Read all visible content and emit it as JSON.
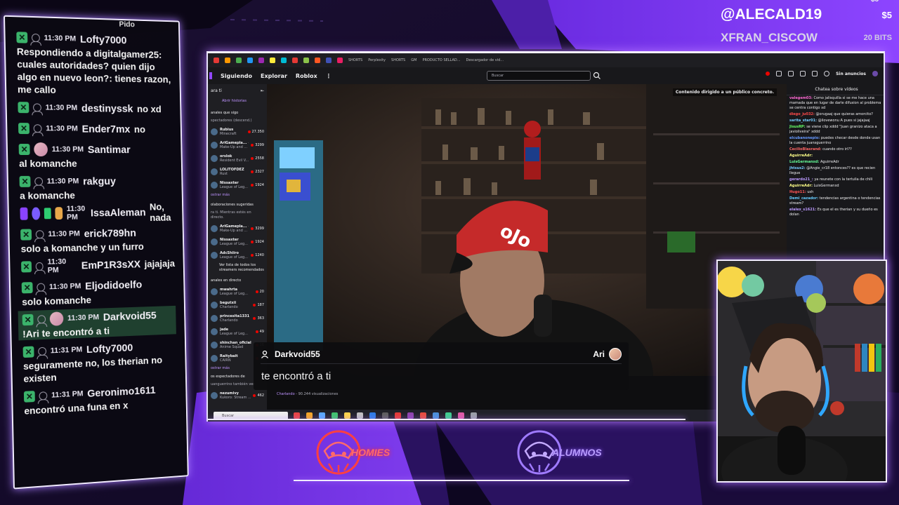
{
  "bits": {
    "top_amount": "$5",
    "row1": {
      "name": "@ALECALD19",
      "amount": "$5"
    },
    "row2": {
      "name": "XFRAN_CISCOW",
      "amount": "20 BITS"
    }
  },
  "stream_chat": {
    "messages": [
      {
        "time": "11:30 PM",
        "user": "Lofty7000",
        "text": "Respondiendo a digitalgamer25: cuales autoridades? quien dijo algo en nuevo leon?: tienes razon, me callo",
        "badges": [
          "mod",
          "user"
        ]
      },
      {
        "time": "11:30 PM",
        "user": "destinyssk",
        "text": "no xd",
        "badges": [
          "mod",
          "user"
        ]
      },
      {
        "time": "11:30 PM",
        "user": "Ender7mx",
        "text": "no",
        "badges": [
          "mod",
          "user"
        ]
      },
      {
        "time": "11:30 PM",
        "user": "Santimar",
        "text": "al komanche",
        "badges": [
          "mod",
          "avatar"
        ]
      },
      {
        "time": "11:30 PM",
        "user": "rakguy",
        "text": "a komanche",
        "badges": [
          "mod",
          "user"
        ]
      },
      {
        "time": "11:30 PM",
        "user": "IssaAleman",
        "text": "No, nada",
        "badges": [
          "twitch",
          "sub",
          "gift",
          "emote"
        ]
      },
      {
        "time": "11:30 PM",
        "user": "erick789hn",
        "text": "solo a komanche y un furro",
        "badges": [
          "mod",
          "user"
        ]
      },
      {
        "time": "11:30 PM",
        "user": "EmP1R3sXX",
        "text": "jajajaja",
        "badges": [
          "mod",
          "user"
        ]
      },
      {
        "time": "11:30 PM",
        "user": "Eljodidoelfo",
        "text": "solo komanche",
        "badges": [
          "mod",
          "user"
        ]
      },
      {
        "time": "11:30 PM",
        "user": "Darkvoid55",
        "text": "!Ari te encontró a ti",
        "badges": [
          "mod",
          "user",
          "avatar"
        ],
        "highlight": true
      },
      {
        "time": "11:31 PM",
        "user": "Lofty7000",
        "text": "seguramente no, los therian no existen",
        "badges": [
          "mod",
          "user"
        ]
      },
      {
        "time": "11:31 PM",
        "user": "Geronimo1611",
        "text": "encontró una funa en x",
        "badges": [
          "mod",
          "user"
        ]
      }
    ],
    "top_cut_text": "Pido"
  },
  "browser": {
    "tabs": [
      "SHORTS",
      "Perplexity",
      "SHORTS",
      "GM",
      "PRODUCTO SELLAD...",
      "Descargador de vid..."
    ],
    "nav": {
      "following": "Siguiendo",
      "explore": "Explorar",
      "roblox": "Roblox",
      "more": "⋮"
    },
    "search_placeholder": "Buscar",
    "no_ads": "Sin anuncios",
    "content_warning": "Contenido dirigido a un público concreto.",
    "sidebar": {
      "header": "ara ti",
      "stories": "Abrir historias",
      "section1": "anales que sigo",
      "section1_sub": "spectadores (descend.)",
      "followed": [
        {
          "name": "Rubius",
          "game": "Minecraft",
          "viewers": "27.350"
        },
        {
          "name": "AriGamepla... +1",
          "game": "Make-Up and ...",
          "viewers": "3299"
        },
        {
          "name": "orslok",
          "game": "Resident Evil V...",
          "viewers": "2558"
        },
        {
          "name": "LOLITOFDEZ",
          "game": "Rust",
          "viewers": "2327"
        },
        {
          "name": "Nissaxter",
          "game": "League of Leg...",
          "viewers": "1924"
        }
      ],
      "show_more": "ostrar más",
      "section2": "olaboraciones sugeridas",
      "section2_sub": "ra ti. Mientras estés en directo.",
      "collabs": [
        {
          "name": "AriGamepla... +1",
          "game": "Make-Up and ...",
          "viewers": "3299"
        },
        {
          "name": "Nissaxter",
          "game": "League of Leg...",
          "viewers": "1924"
        },
        {
          "name": "AdcShiiro",
          "game": "League of Leg...",
          "viewers": "1240"
        }
      ],
      "see_all": "Ver lista de todos los streamers recomendados",
      "section3": "anales en directo",
      "live": [
        {
          "name": "mwahrta",
          "game": "League of Leg...",
          "viewers": "20"
        },
        {
          "name": "begutxii",
          "game": "Charlando",
          "viewers": "187"
        },
        {
          "name": "princesita1331",
          "game": "Charlando",
          "viewers": "363"
        },
        {
          "name": "jade",
          "game": "League of Leg...",
          "viewers": "49"
        },
        {
          "name": "shinchan_oficial",
          "game": "Anime Squad",
          "viewers": "16"
        },
        {
          "name": "Raitybait",
          "game": "CAIRN",
          "viewers": "16"
        }
      ],
      "show_more2": "ostrar más",
      "section4": "os espectadores de",
      "section4_sub": "uanguerrino también ven",
      "also": [
        {
          "name": "nezumivy",
          "game": "Kukoro: Stream ...",
          "viewers": "462"
        }
      ]
    },
    "video_meta": {
      "category": "Charlando",
      "views": " - 90.244 visualizaciones"
    },
    "twitch_chat": {
      "title": "Chatea sobre vídeos",
      "lines": [
        {
          "user": "valegem03:",
          "text": "Como jalisquilla si se me hace una mamada que en lugar de darle difusion al problema se centra contigo xd",
          "color": "#ff6ad5"
        },
        {
          "user": "diego_ju032:",
          "text": "@orugaaj que quieras amorcito?",
          "color": "#ff4b4b"
        },
        {
          "user": "sarita_star01:",
          "text": "@ilovewonu A pues si jajajaaj",
          "color": "#7cf"
        },
        {
          "user": "JisusRP:",
          "text": "se viene clip xddd \"Juan granizo ataca a javioliveira\" xddd",
          "color": "#6f6"
        },
        {
          "user": "elcubanonepio:",
          "text": "puedes checar desde donde usan la cuenta juansguerrino",
          "color": "#69f"
        },
        {
          "user": "CecilioBlasrand:",
          "text": "cuando otro irl??",
          "color": "#f66"
        },
        {
          "user": "AguirreAdr:",
          "text": "",
          "color": "#ff8"
        },
        {
          "user": "LuisGermanxd:",
          "text": "AguirreAdr",
          "color": "#6f9"
        },
        {
          "user": "jhtsus2:",
          "text": "@Angie_cr18 entonces?? es que recien llegue",
          "color": "#7cf"
        },
        {
          "user": "gerardo21_:",
          "text": "ya reunete con la tertulia de chili",
          "color": "#b9f"
        },
        {
          "user": "AguirreAdr:",
          "text": "LuisGermanxd",
          "color": "#ff8"
        },
        {
          "user": "Hugo11:",
          "text": "ush",
          "color": "#f55"
        },
        {
          "user": "Demi_cazador:",
          "text": "tendencias argentina o tendencias stream?",
          "color": "#6cf"
        },
        {
          "user": "elalex_s1621:",
          "text": "Es que el es therian y su dueño es dolan",
          "color": "#b9f"
        }
      ]
    },
    "taskbar_search": "Buscar"
  },
  "overlay_message": {
    "user": "Darkvoid55",
    "recipient": "Ari",
    "text": "te encontró a ti"
  },
  "teams": {
    "left": "HOMIES",
    "right": "ALUMNOS"
  },
  "colors": {
    "accent": "#8a3dff",
    "panel": "#0a0812",
    "glow": "#b07aff"
  }
}
